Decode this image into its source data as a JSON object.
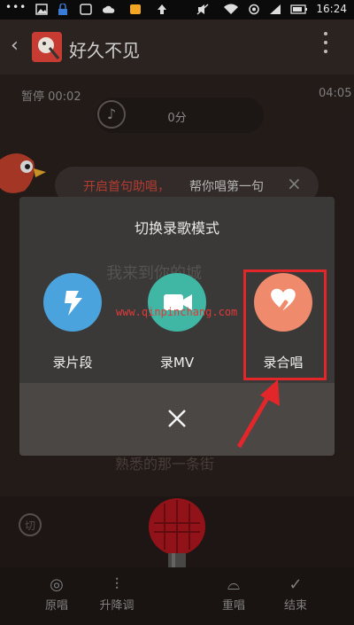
{
  "status_bar": {
    "time": "16:24",
    "dots": "•••"
  },
  "header": {
    "back_icon": "‹",
    "title": "好久不见"
  },
  "progress": {
    "state_time": "暂停 00:02",
    "total_time": "04:05",
    "score": "0分"
  },
  "tip": {
    "red_text": "开启首句助唱，",
    "white_text": "帮你唱第一句",
    "close": "×"
  },
  "lyrics_ghost": [
    "我来到你的城",
    "熟悉的那一条街"
  ],
  "dialog": {
    "title": "切换录歌模式",
    "options": [
      {
        "label": "录片段",
        "icon": "segment-icon",
        "color": "#4aa3dc"
      },
      {
        "label": "录MV",
        "icon": "video-camera-icon",
        "color": "#3fb7a4"
      },
      {
        "label": "录合唱",
        "icon": "chorus-icon",
        "color": "#f08a6d"
      }
    ],
    "close_glyph": "×"
  },
  "watermark": "www.qinpinchang.com",
  "bottom": {
    "items": [
      {
        "label": "原唱",
        "icon": "original-icon"
      },
      {
        "label": "升降调",
        "icon": "pitch-icon"
      },
      {
        "label": "重唱",
        "icon": "rerecord-icon"
      },
      {
        "label": "结束",
        "icon": "check-icon"
      }
    ],
    "side_label": "切"
  },
  "colors": {
    "accent_red": "#e2262a",
    "tip_red": "#d94a3e"
  }
}
